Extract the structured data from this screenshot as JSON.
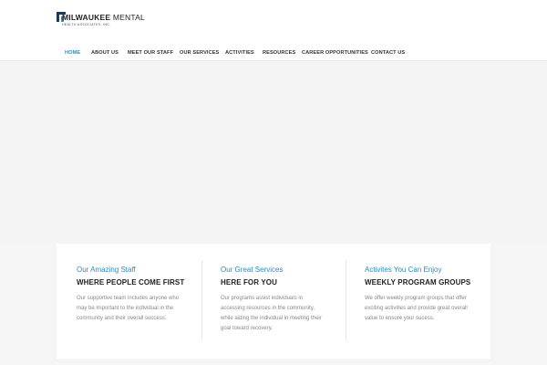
{
  "brand": {
    "name_bold": "MILWAUKEE",
    "name_regular": "MENTAL",
    "tagline": "HEALTH ASSOCIATES, INC."
  },
  "nav": {
    "items": [
      {
        "label": "HOME",
        "active": true
      },
      {
        "label": "ABOUT US",
        "active": false
      },
      {
        "label": "MEET OUR STAFF",
        "active": false
      },
      {
        "label": "OUR SERVICES",
        "active": false
      },
      {
        "label": "ACTIVITIES",
        "active": false
      },
      {
        "label": "RESOURCES",
        "active": false
      },
      {
        "label": "CAREER OPPORTUNITIES",
        "active": false
      },
      {
        "label": "CONTACT US",
        "active": false
      }
    ]
  },
  "features": [
    {
      "subtitle": "Our Amazing Staff",
      "title": "WHERE PEOPLE COME FIRST",
      "text": "Our supportive team includes anyone who may be important to the individual in the community and their overall success."
    },
    {
      "subtitle": "Our Great Services",
      "title": "HERE FOR YOU",
      "text": "Our programs assist individuals in accessing resources in the community, while aiding the individual in meeting their goal toward recovery."
    },
    {
      "subtitle": "Activites You Can Enjoy",
      "title": "WEEKLY PROGRAM GROUPS",
      "text": "We offer weekly program groups that offer exciting activities and provide great overall value  to ensure your sucess."
    }
  ],
  "colors": {
    "accent": "#2b8cc4",
    "brand_dark": "#1f3a5f",
    "page_bg": "#f5f5f5"
  }
}
